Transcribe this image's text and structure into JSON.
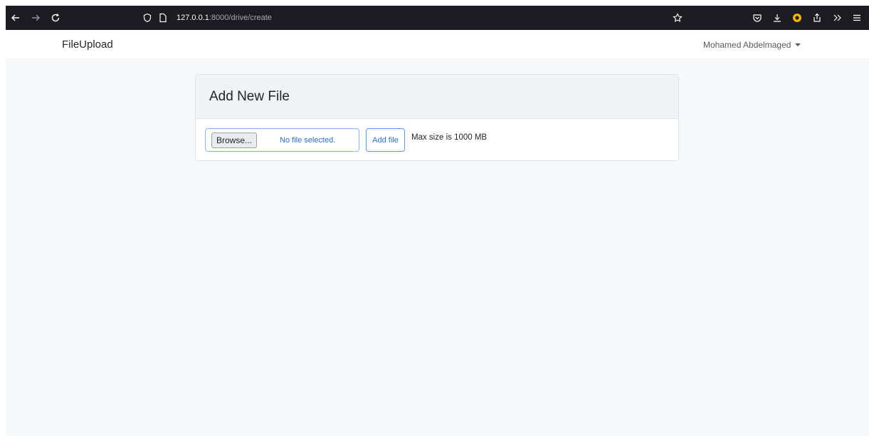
{
  "browser": {
    "url_host": "127.0.0.1",
    "url_path": ":8000/drive/create",
    "icons": {
      "back": "arrow-left-icon",
      "forward": "arrow-right-icon",
      "reload": "reload-icon",
      "shield": "shield-icon",
      "page": "page-icon",
      "bookmark": "star-icon",
      "pocket": "pocket-icon",
      "downloads": "download-icon",
      "extension": "extension-icon",
      "share": "share-icon",
      "overflow": "chevrons-right-icon",
      "menu": "hamburger-menu-icon"
    }
  },
  "navbar": {
    "brand": "FileUpload",
    "user_name": "Mohamed Abdelmaged"
  },
  "card": {
    "title": "Add New File",
    "browse_label": "Browse...",
    "file_status": "No file selected.",
    "submit_label": "Add file",
    "max_size_text": "Max size is 1000 MB"
  },
  "colors": {
    "browser_bar": "#1c1b22",
    "page_bg": "#f6f8fa",
    "accent": "#2b73d6",
    "extension_badge": "#f5b400"
  }
}
